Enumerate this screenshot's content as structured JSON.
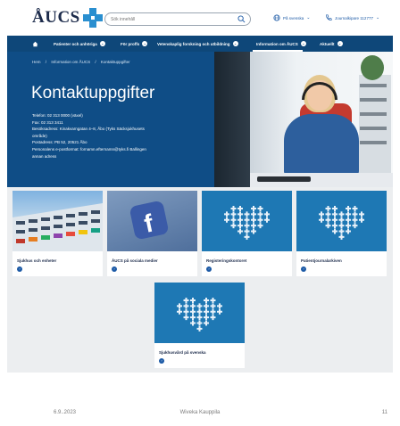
{
  "header": {
    "logo_text": "ÅUCS",
    "search_placeholder": "Sök innehåll",
    "links": [
      {
        "label": "På svenska",
        "icon": "globe-icon"
      },
      {
        "label": "Journalkipare 112777",
        "icon": "phone-icon"
      }
    ]
  },
  "nav": {
    "items": [
      {
        "label": "Patienter och anhöriga"
      },
      {
        "label": "För proffs"
      },
      {
        "label": "Vetenskaplig forskning och utbildning"
      },
      {
        "label": "Information om ÅUCS"
      },
      {
        "label": "Aktuellt"
      }
    ],
    "active_index": 3
  },
  "breadcrumb": [
    "Hem",
    "/",
    "Information om ÅUCS",
    "/",
    "Kontaktuppgifter"
  ],
  "hero": {
    "title": "Kontaktuppgifter",
    "lines": [
      "Telefon: 02 313 0000 (växel)",
      "Fax: 02 313 3411",
      "Besöksadress: Kinakvarngatan 4–8, Åbo (Tyks Säcksjukhusets",
      "område)",
      "Postadress: PB 52, 20521 Åbo",
      "Personalens e-postformat: fornamn.efternamn@tyks.fi Ballingen",
      "annan adress"
    ]
  },
  "cards": [
    {
      "title": "Sjukhus och enheter"
    },
    {
      "title": "ÅUCS på sociala medier"
    },
    {
      "title": "Registeringskontoret"
    },
    {
      "title": "Patientjournalarkiven"
    },
    {
      "title": "Sjukhusvård på svenska"
    }
  ],
  "footer": {
    "date": "6.9..2023",
    "name": "Wiveka Kauppila",
    "page": "11"
  },
  "colors": {
    "brand_navy": "#0e4779",
    "hero_blue": "#0f4d86",
    "card_blue": "#1e78b4",
    "accent_blue": "#2a8fd0"
  }
}
